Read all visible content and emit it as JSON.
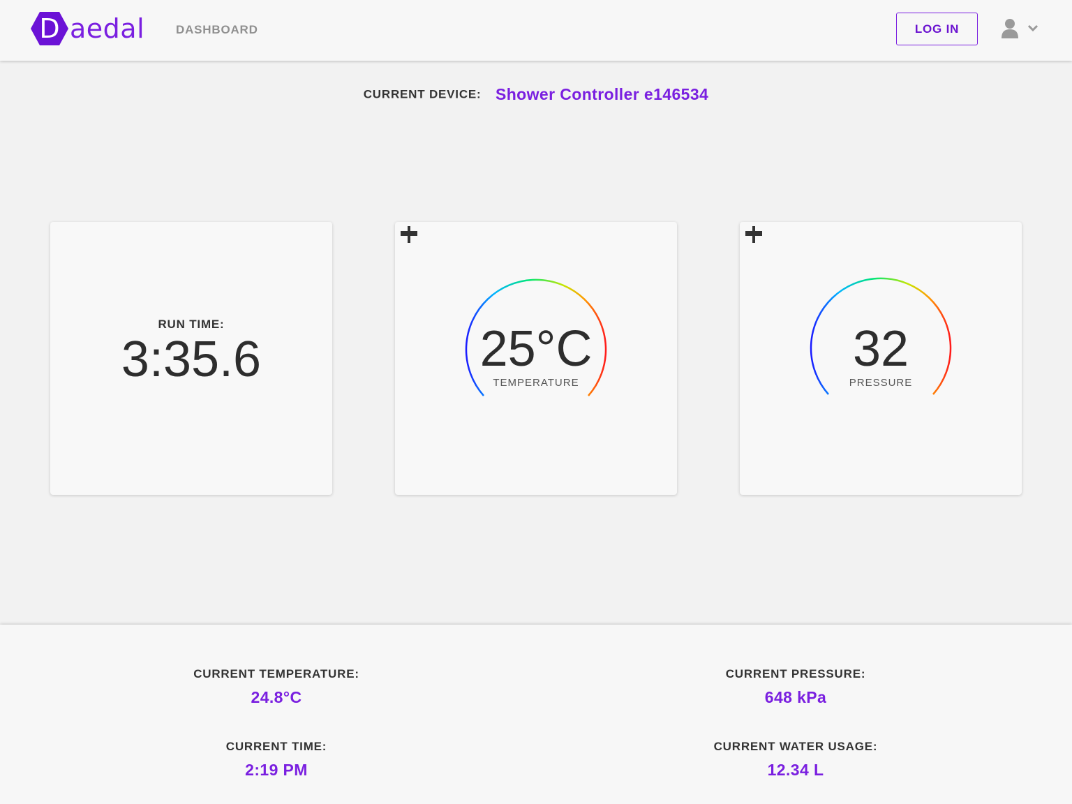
{
  "header": {
    "logo_initial": "D",
    "logo_rest": "aedal",
    "nav_dashboard": "DASHBOARD",
    "login_label": "LOG IN",
    "user_icon": "user-icon",
    "dropdown_icon": "chevron-down-icon"
  },
  "device": {
    "label": "CURRENT DEVICE:",
    "name": "Shower Controller e146534"
  },
  "cards": {
    "run_time": {
      "label": "RUN TIME:",
      "value": "3:35.6"
    },
    "temperature": {
      "value": "25°C",
      "label": "TEMPERATURE",
      "plus_icon": "plus-icon",
      "minus_icon": "minus-icon"
    },
    "pressure": {
      "value": "32",
      "label": "PRESSURE",
      "plus_icon": "plus-icon",
      "minus_icon": "minus-icon"
    }
  },
  "stats": {
    "temperature": {
      "label": "CURRENT TEMPERATURE:",
      "value": "24.8°C"
    },
    "pressure": {
      "label": "CURRENT PRESSURE:",
      "value": "648 kPa"
    },
    "time": {
      "label": "CURRENT TIME:",
      "value": "2:19 PM"
    },
    "water": {
      "label": "CURRENT WATER USAGE:",
      "value": "12.34 L"
    }
  },
  "colors": {
    "brand": "#7a1fe0",
    "gauge_gradient": [
      "#1a1aff",
      "#00b4ff",
      "#00e676",
      "#c8e600",
      "#ff9800",
      "#ff1a1a"
    ]
  }
}
